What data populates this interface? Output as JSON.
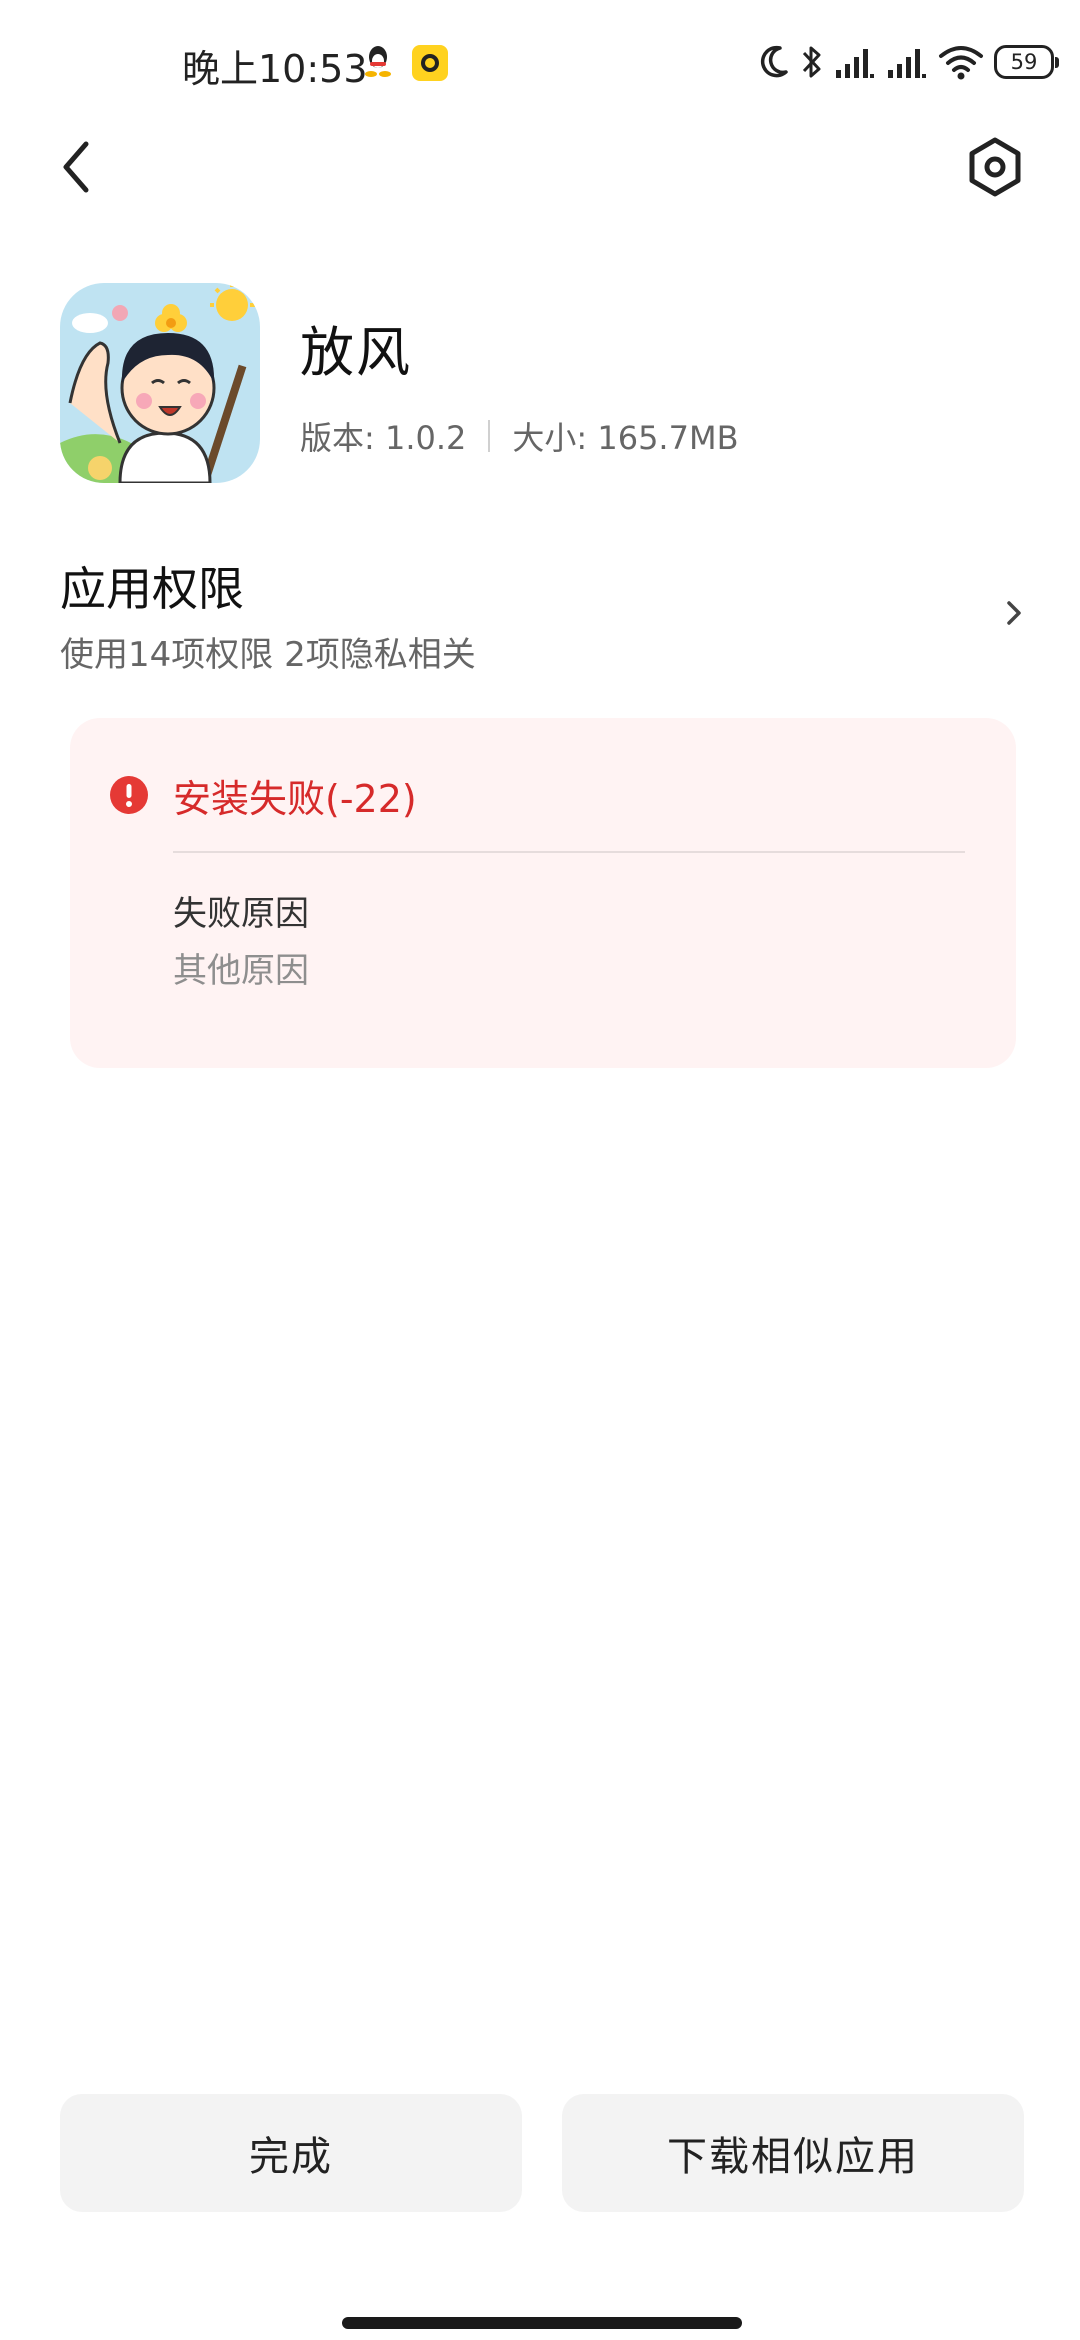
{
  "status_bar": {
    "time": "晚上10:53",
    "battery": "59",
    "icons": [
      "qq-notification-icon",
      "app-notification-icon",
      "moon-icon",
      "bluetooth-icon",
      "signal-icon",
      "signal-icon",
      "wifi-icon",
      "battery-icon"
    ]
  },
  "toolbar": {
    "back_icon": "chevron-left-icon",
    "settings_icon": "hexagon-settings-icon"
  },
  "app": {
    "name": "放风",
    "version": "版本: 1.0.2",
    "size": "大小: 165.7MB"
  },
  "permissions": {
    "title": "应用权限",
    "subtitle": "使用14项权限 2项隐私相关"
  },
  "error": {
    "title": "安装失败(-22)",
    "reason_label": "失败原因",
    "reason_value": "其他原因",
    "color": "#d62a2a",
    "background": "#fff3f3"
  },
  "buttons": {
    "done": "完成",
    "similar": "下载相似应用"
  }
}
